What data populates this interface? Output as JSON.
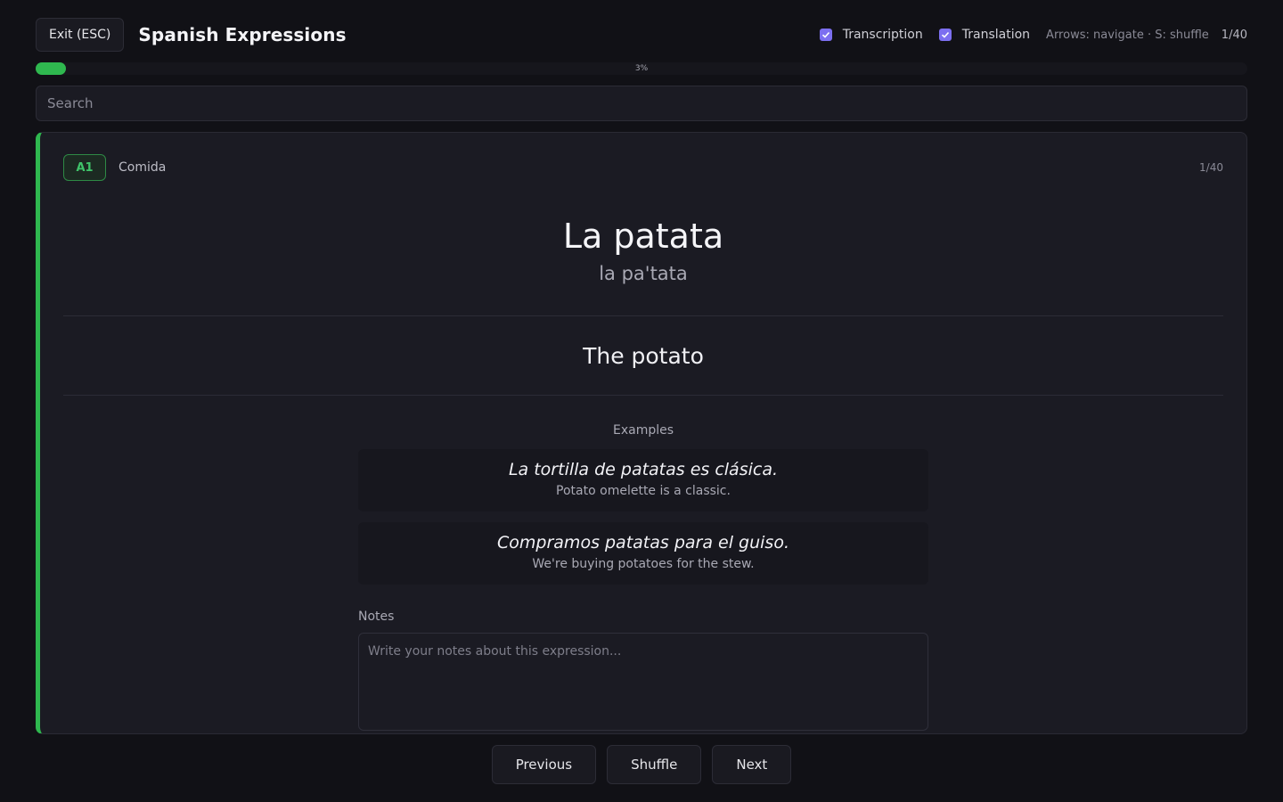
{
  "header": {
    "exit_label": "Exit (ESC)",
    "title": "Spanish Expressions",
    "toggles": [
      {
        "label": "Transcription",
        "checked": true
      },
      {
        "label": "Translation",
        "checked": true
      }
    ],
    "hint": "Arrows: navigate · S: shuffle",
    "counter": "1/40"
  },
  "progress": {
    "percent_label": "3%",
    "fraction": 0.025
  },
  "search": {
    "placeholder": "Search",
    "value": ""
  },
  "card": {
    "level": "A1",
    "category": "Comida",
    "counter": "1/40",
    "phrase": "La patata",
    "transcription": "la pa'tata",
    "translation": "The potato",
    "examples_title": "Examples",
    "examples": [
      {
        "es": "La tortilla de patatas es clásica.",
        "en": "Potato omelette is a classic."
      },
      {
        "es": "Compramos patatas para el guiso.",
        "en": "We're buying potatoes for the stew."
      }
    ],
    "notes_label": "Notes",
    "notes_placeholder": "Write your notes about this expression..."
  },
  "nav": {
    "previous": "Previous",
    "shuffle": "Shuffle",
    "next": "Next"
  },
  "colors": {
    "accent": "#2fb84f",
    "checkbox": "#7c6ff0",
    "background": "#111116"
  }
}
